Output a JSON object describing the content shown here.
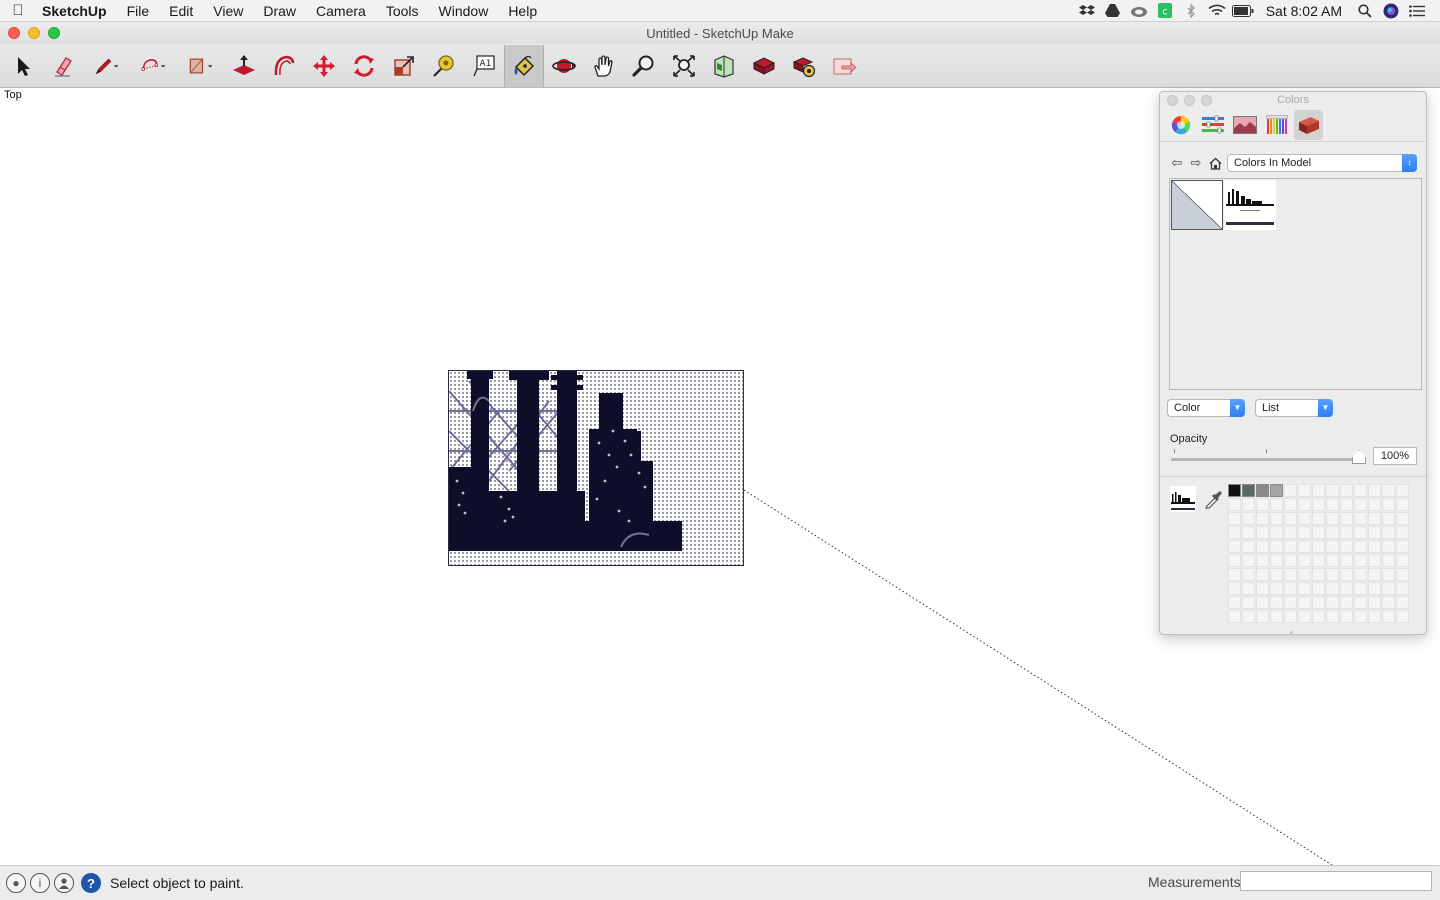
{
  "menubar": {
    "app_name": "SketchUp",
    "items": [
      "File",
      "Edit",
      "View",
      "Draw",
      "Camera",
      "Tools",
      "Window",
      "Help"
    ],
    "clock": "Sat 8:02 AM",
    "tray_icons": [
      "dropbox-icon",
      "drive-icon",
      "creative-cloud-icon",
      "evernote-icon",
      "bluetooth-icon",
      "wifi-icon",
      "battery-icon",
      "spotlight-icon",
      "siri-icon",
      "notification-center-icon"
    ]
  },
  "window": {
    "title": "Untitled - SketchUp Make"
  },
  "toolbar": {
    "tools": [
      {
        "name": "select-tool",
        "icon": "arrow-cursor-icon"
      },
      {
        "name": "eraser-tool",
        "icon": "eraser-icon"
      },
      {
        "name": "line-tool",
        "icon": "pencil-icon",
        "has_dropdown": true
      },
      {
        "name": "arc-tool",
        "icon": "arc-icon",
        "has_dropdown": true
      },
      {
        "name": "shape-tool",
        "icon": "rectangle-icon",
        "has_dropdown": true
      },
      {
        "name": "push-pull-tool",
        "icon": "push-pull-icon"
      },
      {
        "name": "offset-tool",
        "icon": "offset-icon"
      },
      {
        "name": "move-tool",
        "icon": "move-icon"
      },
      {
        "name": "rotate-tool",
        "icon": "rotate-icon"
      },
      {
        "name": "scale-tool",
        "icon": "scale-icon"
      },
      {
        "name": "tape-measure-tool",
        "icon": "tape-measure-icon"
      },
      {
        "name": "text-tool",
        "icon": "text-icon"
      },
      {
        "name": "paint-bucket-tool",
        "icon": "paint-bucket-icon",
        "active": true
      },
      {
        "name": "orbit-tool",
        "icon": "orbit-icon"
      },
      {
        "name": "pan-tool",
        "icon": "hand-icon"
      },
      {
        "name": "zoom-tool",
        "icon": "magnifier-icon"
      },
      {
        "name": "zoom-extents-tool",
        "icon": "zoom-extents-icon"
      },
      {
        "name": "warehouse-tool",
        "icon": "warehouse-icon"
      },
      {
        "name": "extension-warehouse-tool",
        "icon": "extension-warehouse-icon"
      },
      {
        "name": "extension-manager-tool",
        "icon": "extension-manager-icon"
      },
      {
        "name": "send-to-layout-tool",
        "icon": "layout-icon"
      }
    ]
  },
  "viewport": {
    "view_label": "Top"
  },
  "colors_panel": {
    "title": "Colors",
    "tabs": [
      "color-wheel-icon",
      "color-sliders-icon",
      "color-image-icon",
      "crayons-icon",
      "brick-icon"
    ],
    "collection": "Colors In Model",
    "view_mode": "Color",
    "list_mode": "List",
    "opacity_label": "Opacity",
    "opacity_value": "100%",
    "opacity": 1.0,
    "palette_filled": [
      "#111111",
      "#5a6a5e",
      "#8a8a8a",
      "#a6a6a6"
    ]
  },
  "statusbar": {
    "hint": "Select object to paint.",
    "measurements_label": "Measurements",
    "help_glyph": "?"
  }
}
